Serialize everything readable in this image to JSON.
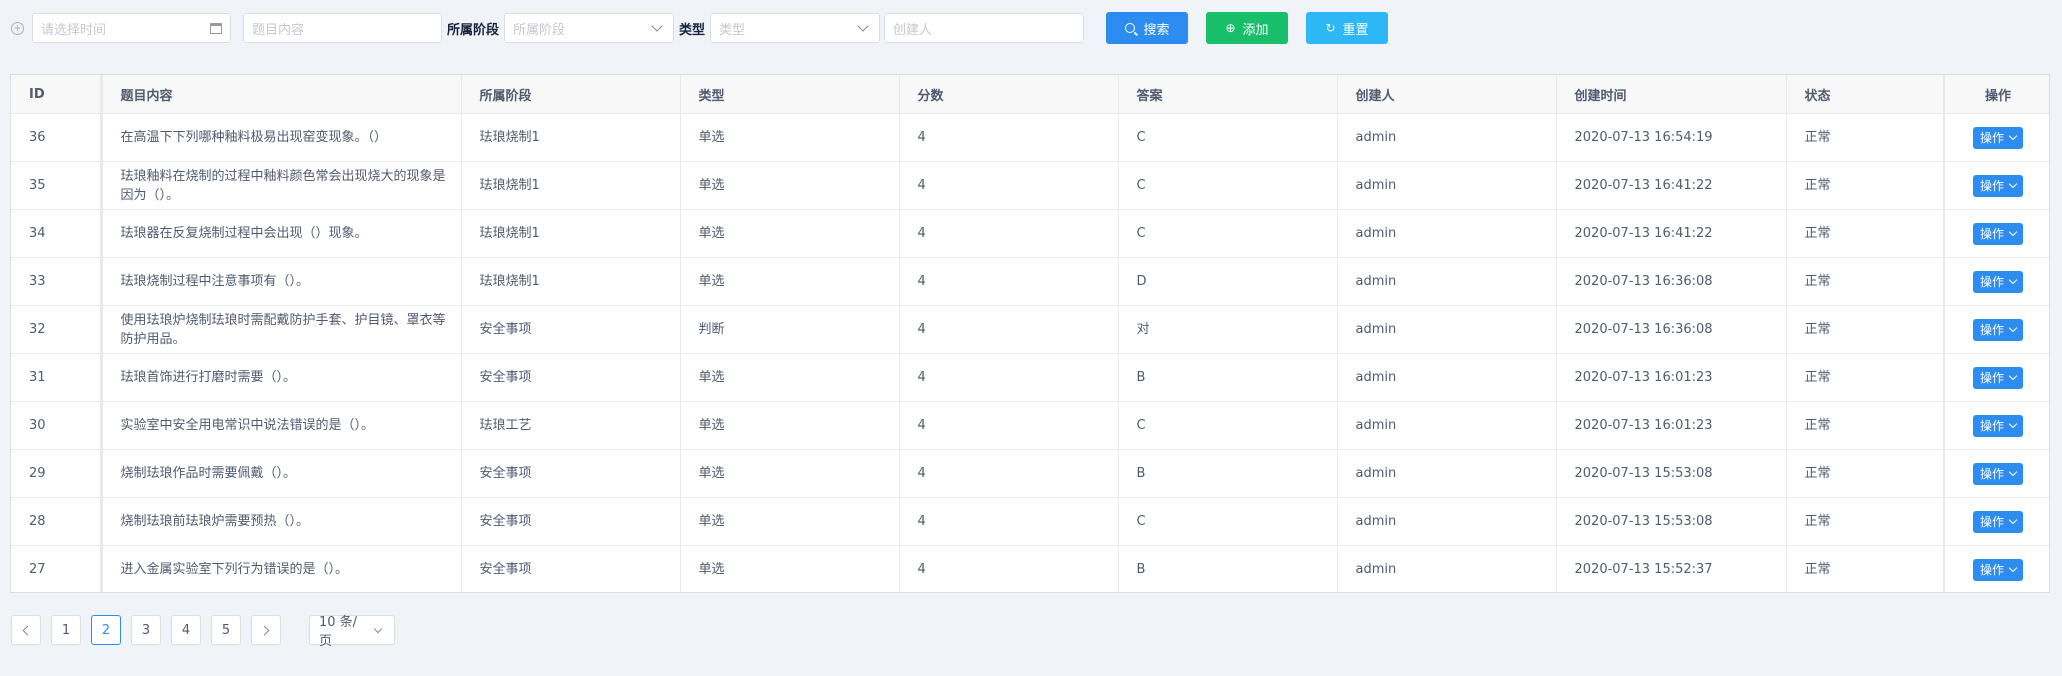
{
  "filters": {
    "time_placeholder": "请选择时间",
    "content_placeholder": "题目内容",
    "stage_label": "所属阶段",
    "stage_placeholder": "所属阶段",
    "type_label": "类型",
    "type_placeholder": "类型",
    "creator_placeholder": "创建人"
  },
  "buttons": {
    "search": "搜索",
    "add": "添加",
    "reset": "重置"
  },
  "table": {
    "headers": [
      "ID",
      "题目内容",
      "所属阶段",
      "类型",
      "分数",
      "答案",
      "创建人",
      "创建时间",
      "状态",
      "操作"
    ],
    "op_label": "操作",
    "rows": [
      {
        "id": "36",
        "content": "在高温下下列哪种釉料极易出现窑变现象。（）",
        "stage": "珐琅烧制1",
        "type": "单选",
        "score": "4",
        "answer": "C",
        "creator": "admin",
        "created": "2020-07-13 16:54:19",
        "status": "正常"
      },
      {
        "id": "35",
        "content": "珐琅釉料在烧制的过程中釉料颜色常会出现烧大的现象是因为（）。",
        "stage": "珐琅烧制1",
        "type": "单选",
        "score": "4",
        "answer": "C",
        "creator": "admin",
        "created": "2020-07-13 16:41:22",
        "status": "正常"
      },
      {
        "id": "34",
        "content": "珐琅器在反复烧制过程中会出现（）现象。",
        "stage": "珐琅烧制1",
        "type": "单选",
        "score": "4",
        "answer": "C",
        "creator": "admin",
        "created": "2020-07-13 16:41:22",
        "status": "正常"
      },
      {
        "id": "33",
        "content": "珐琅烧制过程中注意事项有（）。",
        "stage": "珐琅烧制1",
        "type": "单选",
        "score": "4",
        "answer": "D",
        "creator": "admin",
        "created": "2020-07-13 16:36:08",
        "status": "正常"
      },
      {
        "id": "32",
        "content": "使用珐琅炉烧制珐琅时需配戴防护手套、护目镜、罩衣等防护用品。",
        "stage": "安全事项",
        "type": "判断",
        "score": "4",
        "answer": "对",
        "creator": "admin",
        "created": "2020-07-13 16:36:08",
        "status": "正常"
      },
      {
        "id": "31",
        "content": "珐琅首饰进行打磨时需要（）。",
        "stage": "安全事项",
        "type": "单选",
        "score": "4",
        "answer": "B",
        "creator": "admin",
        "created": "2020-07-13 16:01:23",
        "status": "正常"
      },
      {
        "id": "30",
        "content": "实验室中安全用电常识中说法错误的是（）。",
        "stage": "珐琅工艺",
        "type": "单选",
        "score": "4",
        "answer": "C",
        "creator": "admin",
        "created": "2020-07-13 16:01:23",
        "status": "正常"
      },
      {
        "id": "29",
        "content": "烧制珐琅作品时需要佩戴（）。",
        "stage": "安全事项",
        "type": "单选",
        "score": "4",
        "answer": "B",
        "creator": "admin",
        "created": "2020-07-13 15:53:08",
        "status": "正常"
      },
      {
        "id": "28",
        "content": "烧制珐琅前珐琅炉需要预热（）。",
        "stage": "安全事项",
        "type": "单选",
        "score": "4",
        "answer": "C",
        "creator": "admin",
        "created": "2020-07-13 15:53:08",
        "status": "正常"
      },
      {
        "id": "27",
        "content": "进入金属实验室下列行为错误的是（）。",
        "stage": "安全事项",
        "type": "单选",
        "score": "4",
        "answer": "B",
        "creator": "admin",
        "created": "2020-07-13 15:52:37",
        "status": "正常"
      }
    ]
  },
  "pagination": {
    "pages": [
      "1",
      "2",
      "3",
      "4",
      "5"
    ],
    "current": "2",
    "page_size": "10 条/页"
  },
  "colors": {
    "primary": "#2d8cf0",
    "success": "#19be6b",
    "info": "#2db7f5"
  },
  "icons": {
    "toggle": "plus-circle-icon",
    "date": "calendar-icon",
    "dropdown": "chevron-down-icon",
    "search": "search-icon",
    "add": "plus-circle-icon",
    "reset": "refresh-icon"
  }
}
